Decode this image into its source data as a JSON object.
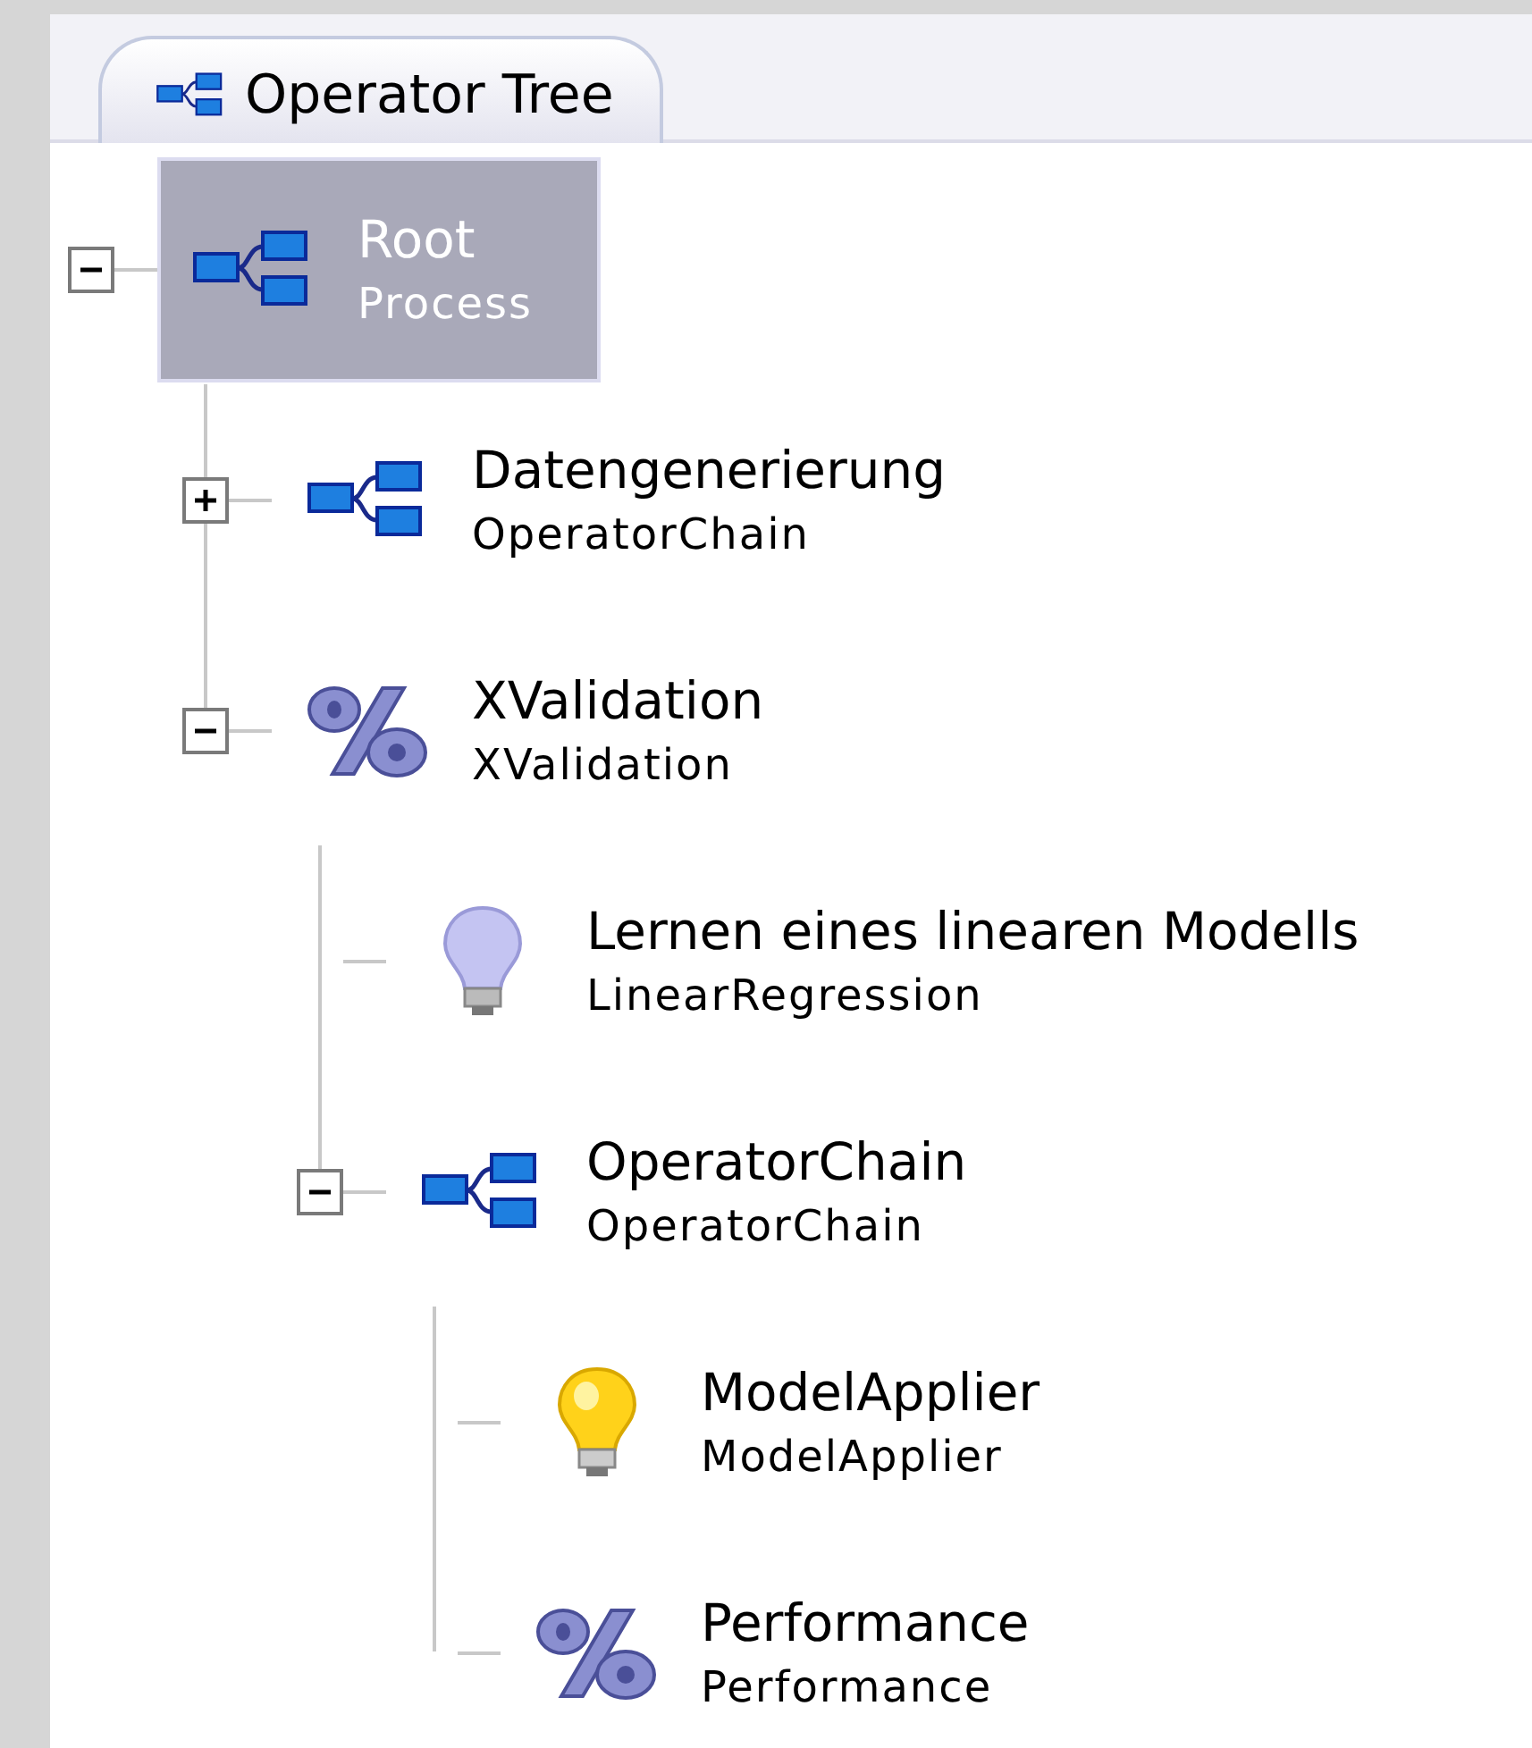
{
  "tab": {
    "title": "Operator Tree",
    "selected": true
  },
  "tree": [
    {
      "name": "Root",
      "type": "Process",
      "kind": "chain",
      "selected": true,
      "expanded": true,
      "children": [
        {
          "name": "Datengenerierung",
          "type": "OperatorChain",
          "kind": "chain",
          "selected": false,
          "expanded": false
        },
        {
          "name": "XValidation",
          "type": "XValidation",
          "kind": "percent",
          "selected": false,
          "expanded": true,
          "children": [
            {
              "name": "Lernen eines linearen Modells",
              "type": "LinearRegression",
              "kind": "learner",
              "selected": false
            },
            {
              "name": "OperatorChain",
              "type": "OperatorChain",
              "kind": "chain",
              "selected": false,
              "expanded": true,
              "children": [
                {
                  "name": "ModelApplier",
                  "type": "ModelApplier",
                  "kind": "applier",
                  "selected": false
                },
                {
                  "name": "Performance",
                  "type": "Performance",
                  "kind": "percent",
                  "selected": false
                }
              ]
            }
          ]
        }
      ]
    }
  ]
}
